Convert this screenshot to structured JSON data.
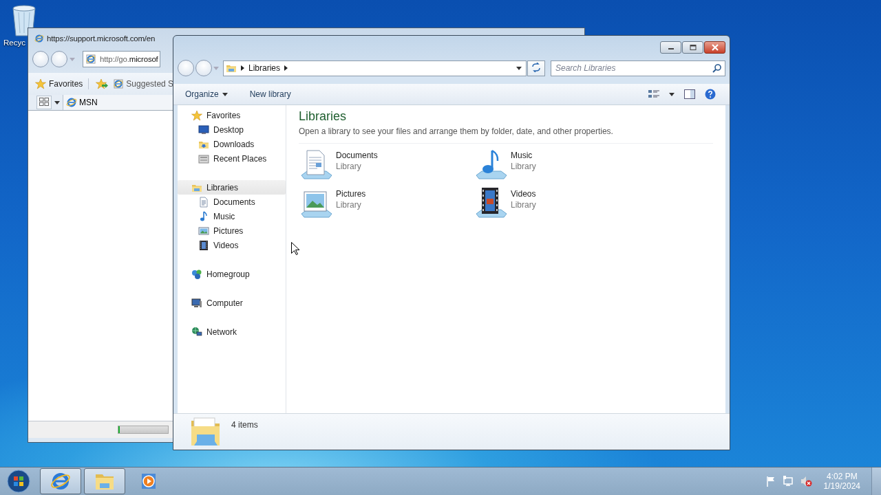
{
  "desktop": {
    "icons": [
      {
        "label": "Recyc",
        "kind": "recycle-bin"
      }
    ]
  },
  "browser_window": {
    "title": "https://support.microsoft.com/en",
    "address": "http://go.**microsof**",
    "favorites_button": "Favorites",
    "favorites_link": "Suggested S",
    "tab": "MSN",
    "status_bar": {
      "level": 0.03
    }
  },
  "explorer_window": {
    "breadcrumb": [
      "Libraries"
    ],
    "search": {
      "placeholder": "Search Libraries"
    },
    "toolbar": [
      {
        "label": "Organize",
        "dropdown": true
      },
      {
        "label": "New library",
        "dropdown": false
      }
    ],
    "nav": [
      {
        "label": "Favorites",
        "kind": "star",
        "selected": false,
        "children": [
          {
            "label": "Desktop",
            "kind": "desktop",
            "selected": false
          },
          {
            "label": "Downloads",
            "kind": "downloads",
            "selected": false
          },
          {
            "label": "Recent Places",
            "kind": "recent",
            "selected": false
          }
        ]
      },
      {
        "label": "Libraries",
        "kind": "libraries",
        "selected": true,
        "children": [
          {
            "label": "Documents",
            "kind": "documents",
            "selected": false
          },
          {
            "label": "Music",
            "kind": "music",
            "selected": false
          },
          {
            "label": "Pictures",
            "kind": "pictures",
            "selected": false
          },
          {
            "label": "Videos",
            "kind": "videos",
            "selected": false
          }
        ]
      },
      {
        "label": "Homegroup",
        "kind": "homegroup",
        "selected": false
      },
      {
        "label": "Computer",
        "kind": "computer",
        "selected": false
      },
      {
        "label": "Network",
        "kind": "network",
        "selected": false
      }
    ],
    "content": {
      "title": "Libraries",
      "subtitle": "Open a library to see your files and arrange them by folder, date, and other properties.",
      "libraries": [
        {
          "name": "Documents",
          "type": "Library",
          "kind": "documents"
        },
        {
          "name": "Music",
          "type": "Library",
          "kind": "music"
        },
        {
          "name": "Pictures",
          "type": "Library",
          "kind": "pictures"
        },
        {
          "name": "Videos",
          "type": "Library",
          "kind": "videos"
        }
      ]
    },
    "details": "4 items"
  },
  "taskbar": {
    "buttons": [
      {
        "kind": "ie",
        "running": true
      },
      {
        "kind": "explorer",
        "running": true
      },
      {
        "kind": "media",
        "running": false
      }
    ],
    "tray": {
      "time": "4:02 PM",
      "date": "1/19/2024"
    }
  }
}
